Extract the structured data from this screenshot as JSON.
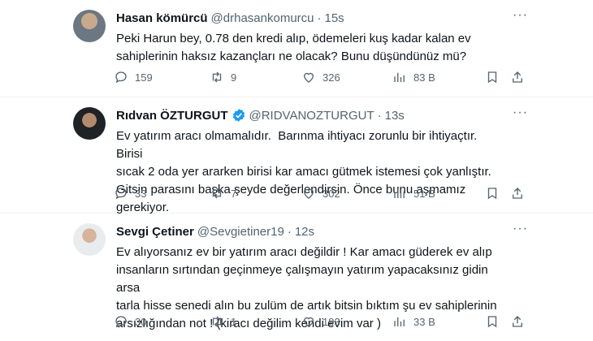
{
  "tweets": [
    {
      "name": "Hasan kömürcü",
      "handle": "@drhasankomurcu",
      "dot": "·",
      "time": "15s",
      "verified": false,
      "text": "Peki Harun bey, 0.78 den kredi alıp, ödemeleri kuş kadar kalan ev\nsahiplerinin haksız kazançları ne olacak? Bunu düşündünüz mü?",
      "replies": "159",
      "retweets": "9",
      "likes": "326",
      "views": "83 B"
    },
    {
      "name": "Rıdvan ÖZTURGUT",
      "handle": "@RIDVANOZTURGUT",
      "dot": "·",
      "time": "13s",
      "verified": true,
      "text": "Ev yatırım aracı olmamalıdır.  Barınma ihtiyacı zorunlu bir ihtiyaçtır. Birisi\nsıcak 2 oda yer ararken birisi kar amacı gütmek istemesi çok yanlıştır.\nGitsin parasını başka şeyde değerlendirsin. Önce bunu aşmamız gerekiyor.",
      "replies": "33",
      "retweets": "7",
      "likes": "302",
      "views": "51 B"
    },
    {
      "name": "Sevgi Çetiner",
      "handle": "@Sevgietiner19",
      "dot": "·",
      "time": "12s",
      "verified": false,
      "text": "Ev alıyorsanız ev bir yatırım aracı değildir ! Kar amacı güderek ev alıp\ninsanların sırtından geçinmeye çalışmayın yatırım yapacaksınız gidin arsa\ntarla hisse senedi alın bu zulüm de artık bitsin bıktım şu ev sahiplerinin\narsızlığından not ! (kiracı değilim kendi evim var )",
      "replies": "30",
      "retweets": "1",
      "likes": "193",
      "views": "33 B"
    }
  ],
  "icons": {
    "more": "more-dots-icon",
    "reply": "reply-icon",
    "retweet": "retweet-icon",
    "like": "heart-icon",
    "views": "views-icon",
    "bookmark": "bookmark-icon",
    "share": "share-icon",
    "verified": "verified-badge-icon"
  },
  "colors": {
    "text": "#0f1419",
    "secondary": "#536471",
    "verified": "#1d9bf0",
    "divider": "#eff3f4"
  }
}
